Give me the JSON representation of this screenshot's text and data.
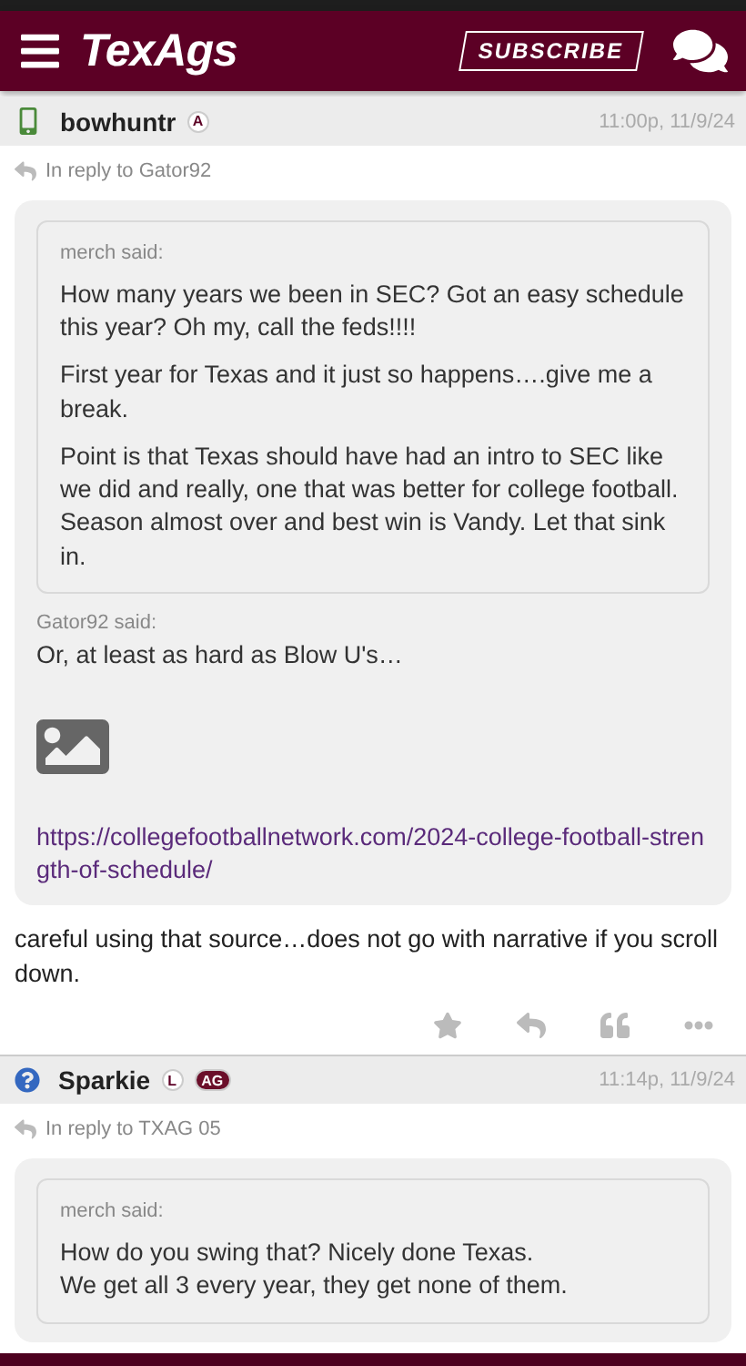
{
  "header": {
    "logo": "TexAgs",
    "subscribe": "SUBSCRIBE"
  },
  "posts": [
    {
      "kind": "phone",
      "user": "bowhuntr",
      "badges": [
        {
          "text": "A",
          "kind": "circle"
        }
      ],
      "time": "11:00p, 11/9/24",
      "reply_to": "In reply to Gator92",
      "quote": {
        "inner": {
          "author": "merch said:",
          "paragraphs": [
            "How many years we been in SEC? Got an easy schedule this year? Oh my, call the feds!!!!",
            "First year for Texas and it just so happens….give me a break.",
            "Point is that Texas should have had an intro to SEC like we did and really, one that was better for college football. Season almost over and best win is Vandy. Let that sink in."
          ]
        },
        "author": "Gator92 said:",
        "text": "Or, at least as hard as Blow U's…",
        "image": true,
        "link": "https://collegefootballnetwork.com/2024-college-football-strength-of-schedule/"
      },
      "body": "careful using that source…does not go with narrative if you scroll down.",
      "actions": true
    },
    {
      "kind": "question",
      "user": "Sparkie",
      "badges": [
        {
          "text": "L",
          "kind": "circle"
        },
        {
          "text": "AG",
          "kind": "pill"
        }
      ],
      "time": "11:14p, 11/9/24",
      "reply_to": "In reply to TXAG 05",
      "quote": {
        "inner": {
          "author": "merch said:",
          "paragraphs": [
            "How do you swing that? Nicely done Texas.\nWe get all 3 every year, they get none of them."
          ]
        }
      }
    }
  ]
}
